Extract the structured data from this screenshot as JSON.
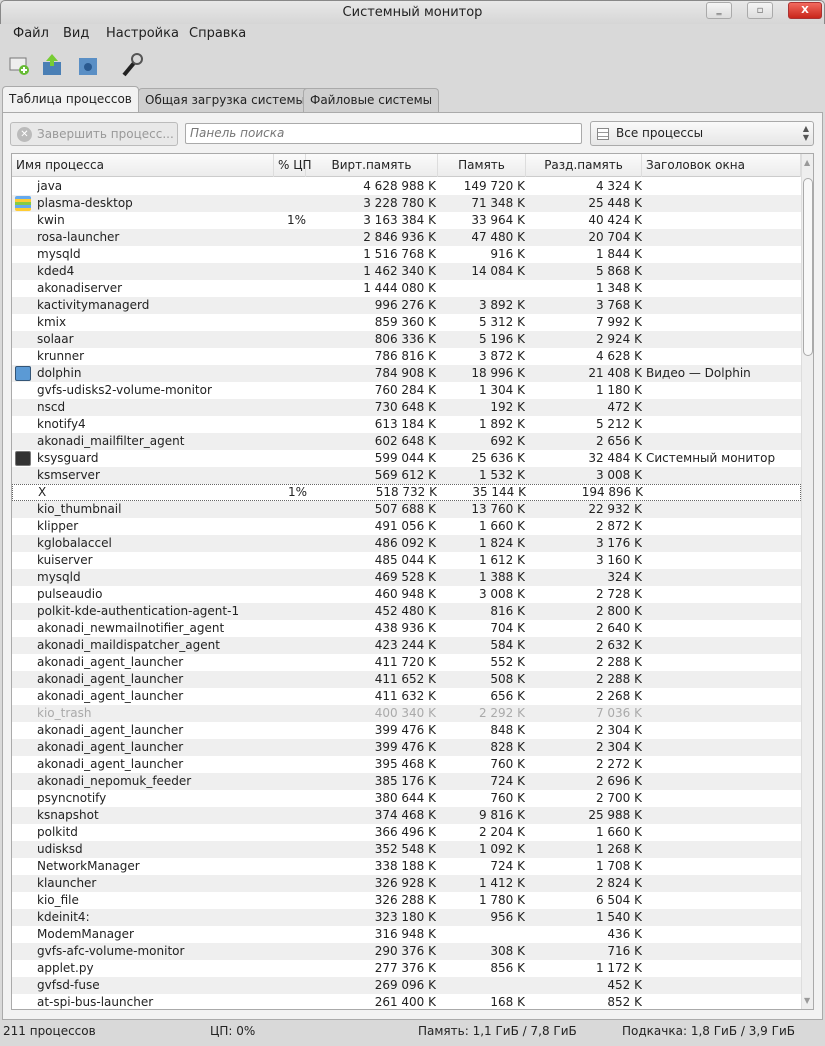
{
  "window": {
    "title": "Системный монитор",
    "minimize": "‗",
    "maximize": "▫",
    "close": "X"
  },
  "menu": [
    "Файл",
    "Вид",
    "Настройка",
    "Справка"
  ],
  "toolbar": [
    {
      "icon": "new-worksheet-icon"
    },
    {
      "icon": "import-worksheet-icon"
    },
    {
      "icon": "download-worksheet-icon"
    },
    {
      "icon": "configure-icon"
    }
  ],
  "tabs": [
    "Таблица процессов",
    "Общая загрузка системы",
    "Файловые системы"
  ],
  "controls": {
    "kill_button": "Завершить процесс...",
    "search_placeholder": "Панель поиска",
    "filter": "Все процессы"
  },
  "columns": [
    "Имя процесса",
    "% ЦП",
    "Вирт.память",
    "Память",
    "Разд.память",
    "Заголовок окна"
  ],
  "rows": [
    [
      "java",
      "",
      "4 628 988 K",
      "149 720 K",
      "4 324 K",
      ""
    ],
    [
      "plasma-desktop",
      "",
      "3 228 780 K",
      "71 348 K",
      "25 448 K",
      "",
      "plasma"
    ],
    [
      "kwin",
      "1%",
      "3 163 384 K",
      "33 964 K",
      "40 424 K",
      ""
    ],
    [
      "rosa-launcher",
      "",
      "2 846 936 K",
      "47 480 K",
      "20 704 K",
      ""
    ],
    [
      "mysqld",
      "",
      "1 516 768 K",
      "916 K",
      "1 844 K",
      ""
    ],
    [
      "kded4",
      "",
      "1 462 340 K",
      "14 084 K",
      "5 868 K",
      ""
    ],
    [
      "akonadiserver",
      "",
      "1 444 080 K",
      "",
      "1 348 K",
      ""
    ],
    [
      "kactivitymanagerd",
      "",
      "996 276 K",
      "3 892 K",
      "3 768 K",
      ""
    ],
    [
      "kmix",
      "",
      "859 360 K",
      "5 312 K",
      "7 992 K",
      ""
    ],
    [
      "solaar",
      "",
      "806 336 K",
      "5 196 K",
      "2 924 K",
      ""
    ],
    [
      "krunner",
      "",
      "786 816 K",
      "3 872 K",
      "4 628 K",
      ""
    ],
    [
      "dolphin",
      "",
      "784 908 K",
      "18 996 K",
      "21 408 K",
      "Видео — Dolphin",
      "dolphin"
    ],
    [
      "gvfs-udisks2-volume-monitor",
      "",
      "760 284 K",
      "1 304 K",
      "1 180 K",
      ""
    ],
    [
      "nscd",
      "",
      "730 648 K",
      "192 K",
      "472 K",
      ""
    ],
    [
      "knotify4",
      "",
      "613 184 K",
      "1 892 K",
      "5 212 K",
      ""
    ],
    [
      "akonadi_mailfilter_agent",
      "",
      "602 648 K",
      "692 K",
      "2 656 K",
      ""
    ],
    [
      "ksysguard",
      "",
      "599 044 K",
      "25 636 K",
      "32 484 K",
      "Системный монитор",
      "ksysguard"
    ],
    [
      "ksmserver",
      "",
      "569 612 K",
      "1 532 K",
      "3 008 K",
      ""
    ],
    [
      "X",
      "1%",
      "518 732 K",
      "35 144 K",
      "194 896 K",
      "",
      "",
      "sel"
    ],
    [
      "kio_thumbnail",
      "",
      "507 688 K",
      "13 760 K",
      "22 932 K",
      ""
    ],
    [
      "klipper",
      "",
      "491 056 K",
      "1 660 K",
      "2 872 K",
      ""
    ],
    [
      "kglobalaccel",
      "",
      "486 092 K",
      "1 824 K",
      "3 176 K",
      ""
    ],
    [
      "kuiserver",
      "",
      "485 044 K",
      "1 612 K",
      "3 160 K",
      ""
    ],
    [
      "mysqld",
      "",
      "469 528 K",
      "1 388 K",
      "324 K",
      ""
    ],
    [
      "pulseaudio",
      "",
      "460 948 K",
      "3 008 K",
      "2 728 K",
      ""
    ],
    [
      "polkit-kde-authentication-agent-1",
      "",
      "452 480 K",
      "816 K",
      "2 800 K",
      ""
    ],
    [
      "akonadi_newmailnotifier_agent",
      "",
      "438 936 K",
      "704 K",
      "2 640 K",
      ""
    ],
    [
      "akonadi_maildispatcher_agent",
      "",
      "423 244 K",
      "584 K",
      "2 632 K",
      ""
    ],
    [
      "akonadi_agent_launcher",
      "",
      "411 720 K",
      "552 K",
      "2 288 K",
      ""
    ],
    [
      "akonadi_agent_launcher",
      "",
      "411 652 K",
      "508 K",
      "2 288 K",
      ""
    ],
    [
      "akonadi_agent_launcher",
      "",
      "411 632 K",
      "656 K",
      "2 268 K",
      ""
    ],
    [
      "kio_trash",
      "",
      "400 340 K",
      "2 292 K",
      "7 036 K",
      "",
      "",
      "dim"
    ],
    [
      "akonadi_agent_launcher",
      "",
      "399 476 K",
      "848 K",
      "2 304 K",
      ""
    ],
    [
      "akonadi_agent_launcher",
      "",
      "399 476 K",
      "828 K",
      "2 304 K",
      ""
    ],
    [
      "akonadi_agent_launcher",
      "",
      "395 468 K",
      "760 K",
      "2 272 K",
      ""
    ],
    [
      "akonadi_nepomuk_feeder",
      "",
      "385 176 K",
      "724 K",
      "2 696 K",
      ""
    ],
    [
      "psyncnotify",
      "",
      "380 644 K",
      "760 K",
      "2 700 K",
      ""
    ],
    [
      "ksnapshot",
      "",
      "374 468 K",
      "9 816 K",
      "25 988 K",
      ""
    ],
    [
      "polkitd",
      "",
      "366 496 K",
      "2 204 K",
      "1 660 K",
      ""
    ],
    [
      "udisksd",
      "",
      "352 548 K",
      "1 092 K",
      "1 268 K",
      ""
    ],
    [
      "NetworkManager",
      "",
      "338 188 K",
      "724 K",
      "1 708 K",
      ""
    ],
    [
      "klauncher",
      "",
      "326 928 K",
      "1 412 K",
      "2 824 K",
      ""
    ],
    [
      "kio_file",
      "",
      "326 288 K",
      "1 780 K",
      "6 504 K",
      ""
    ],
    [
      "kdeinit4:",
      "",
      "323 180 K",
      "956 K",
      "1 540 K",
      ""
    ],
    [
      "ModemManager",
      "",
      "316 948 K",
      "",
      "436 K",
      ""
    ],
    [
      "gvfs-afc-volume-monitor",
      "",
      "290 376 K",
      "308 K",
      "716 K",
      ""
    ],
    [
      "applet.py",
      "",
      "277 376 K",
      "856 K",
      "1 172 K",
      ""
    ],
    [
      "gvfsd-fuse",
      "",
      "269 096 K",
      "",
      "452 K",
      ""
    ],
    [
      "at-spi-bus-launcher",
      "",
      "261 400 K",
      "168 K",
      "852 K",
      ""
    ]
  ],
  "status": {
    "processes": "211 процессов",
    "cpu": "ЦП: 0%",
    "memory": "Память: 1,1 ГиБ / 7,8 ГиБ",
    "swap": "Подкачка: 1,8 ГиБ / 3,9 ГиБ"
  }
}
